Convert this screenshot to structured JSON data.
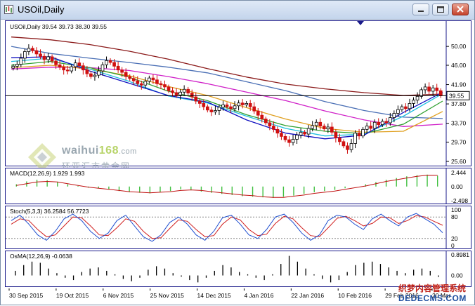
{
  "window": {
    "title": "USOil,Daily"
  },
  "watermark": {
    "site_prefix": "waihui",
    "site_number": "168",
    "site_suffix": ".com",
    "chinese": "环亚汇市黄金网"
  },
  "corner_watermark": {
    "line1": "织梦内容管理系统",
    "line2": "DEDECMS.COM"
  },
  "colors": {
    "pane_border": "#1a1a8a",
    "bull_candle": "#000000",
    "bear_candle": "#d01010",
    "ma_darkred": "#8b1a1a",
    "ma_blue": "#4a6fb5",
    "ma_magenta": "#d020c8",
    "ma_orange": "#e0a020",
    "ma_green": "#30a030",
    "ma_cyan": "#20c0e0",
    "ma_navy": "#1010c0",
    "macd_hist": "#40c040",
    "macd_signal": "#c01010",
    "stoch_main": "#2050d0",
    "stoch_signal": "#d02020",
    "osma_hist": "#000000",
    "price_line": "#000000"
  },
  "chart_data": [
    {
      "id": "price",
      "type": "candlestick",
      "title": "USOil,Daily  39.54 39.73 38.30 39.55",
      "current_price": 39.55,
      "ylim": [
        25.6,
        53.0
      ],
      "yticks": [
        "50.00",
        "46.00",
        "41.90",
        "37.80",
        "33.70",
        "29.70",
        "25.60"
      ],
      "x_labels": [
        "30 Sep 2015",
        "19 Oct 2015",
        "6 Nov 2015",
        "25 Nov 2015",
        "14 Dec 2015",
        "4 Jan 2016",
        "22 Jan 2016",
        "10 Feb 2016",
        "29 Feb 2016",
        "20 Mar"
      ],
      "closes": [
        45.8,
        46.2,
        47.5,
        48.9,
        49.6,
        49.1,
        48.4,
        47.9,
        47.2,
        47.8,
        46.9,
        46.1,
        45.6,
        45.0,
        44.8,
        45.7,
        46.5,
        45.9,
        45.0,
        44.2,
        43.6,
        43.9,
        44.8,
        46.1,
        47.0,
        46.6,
        45.8,
        45.0,
        44.5,
        43.6,
        43.2,
        42.7,
        42.1,
        41.8,
        42.6,
        43.3,
        42.9,
        42.1,
        41.9,
        41.4,
        40.6,
        40.2,
        39.7,
        40.3,
        40.9,
        40.1,
        39.3,
        38.4,
        37.9,
        37.2,
        36.5,
        36.1,
        36.4,
        37.1,
        37.6,
        37.2,
        36.8,
        37.4,
        38.0,
        37.6,
        37.9,
        37.2,
        36.3,
        35.4,
        34.6,
        33.8,
        33.1,
        32.4,
        31.6,
        30.9,
        30.2,
        29.6,
        30.3,
        31.2,
        31.8,
        31.4,
        32.6,
        33.2,
        33.9,
        33.1,
        32.5,
        32.9,
        31.8,
        30.6,
        29.8,
        28.9,
        28.1,
        29.4,
        31.6,
        31.0,
        32.4,
        33.1,
        32.6,
        33.9,
        33.4,
        34.1,
        33.8,
        34.9,
        35.8,
        36.6,
        37.2,
        36.8,
        37.9,
        38.6,
        39.4,
        40.8,
        41.4,
        40.5,
        41.2,
        40.6,
        39.55
      ],
      "moving_averages": [
        {
          "color_key": "ma_darkred",
          "values": [
            52.0,
            51.4,
            50.4,
            49.0,
            47.3,
            45.3,
            43.5,
            42.0,
            41.0,
            40.2,
            39.6,
            39.9
          ]
        },
        {
          "color_key": "ma_blue",
          "values": [
            50.0,
            48.5,
            47.5,
            46.6,
            45.6,
            44.4,
            42.5,
            40.6,
            38.3,
            36.4,
            35.0,
            34.7
          ]
        },
        {
          "color_key": "ma_magenta",
          "values": [
            45.2,
            45.6,
            45.5,
            44.9,
            43.6,
            42.1,
            40.3,
            38.5,
            36.3,
            34.4,
            33.0,
            33.5
          ]
        },
        {
          "color_key": "ma_orange",
          "values": [
            45.5,
            46.0,
            45.2,
            43.8,
            41.5,
            39.6,
            37.0,
            34.6,
            32.6,
            31.8,
            32.0,
            36.2
          ]
        },
        {
          "color_key": "ma_green",
          "values": [
            46.0,
            46.8,
            45.5,
            43.5,
            40.5,
            38.5,
            35.5,
            33.2,
            32.0,
            31.5,
            33.5,
            38.4
          ]
        },
        {
          "color_key": "ma_cyan",
          "values": [
            46.8,
            47.5,
            45.2,
            42.6,
            39.5,
            38.0,
            35.2,
            32.6,
            31.0,
            31.4,
            35.2,
            40.0
          ]
        },
        {
          "color_key": "ma_navy",
          "values": [
            47.6,
            47.8,
            44.8,
            42.2,
            39.6,
            38.2,
            34.4,
            31.6,
            30.4,
            31.2,
            36.0,
            40.3
          ]
        }
      ]
    },
    {
      "id": "macd",
      "type": "histogram",
      "title": "MACD(12,26,9) 1.929 1.993",
      "ylim": [
        -2.498,
        2.444
      ],
      "yticks": [
        "2.444",
        "0.00",
        "-2.498"
      ],
      "hist": [
        0.4,
        0.9,
        1.2,
        1.1,
        0.8,
        0.4,
        0.1,
        -0.2,
        -0.3,
        -0.5,
        -0.8,
        -1.0,
        -1.1,
        -1.2,
        -1.0,
        -0.8,
        -0.5,
        -0.6,
        -0.9,
        -1.1,
        -1.3,
        -1.5,
        -1.7,
        -1.8,
        -1.9,
        -2.0,
        -1.8,
        -1.6,
        -1.3,
        -1.0,
        -0.8,
        -0.6,
        -0.3,
        0.0,
        0.4,
        0.8,
        1.2,
        1.5,
        1.8,
        2.0,
        2.1,
        1.9
      ],
      "signal": [
        0.2,
        0.5,
        0.8,
        0.9,
        0.8,
        0.5,
        0.2,
        -0.1,
        -0.3,
        -0.5,
        -0.7,
        -0.9,
        -1.0,
        -1.1,
        -1.0,
        -0.9,
        -0.7,
        -0.6,
        -0.7,
        -0.9,
        -1.1,
        -1.3,
        -1.5,
        -1.6,
        -1.8,
        -1.9,
        -1.9,
        -1.7,
        -1.5,
        -1.2,
        -1.0,
        -0.8,
        -0.5,
        -0.2,
        0.1,
        0.5,
        0.9,
        1.2,
        1.5,
        1.8,
        2.0,
        1.99
      ]
    },
    {
      "id": "stoch",
      "type": "line",
      "title": "Stoch(5,3,3) 36.2584 56.7723",
      "ylim": [
        0,
        100
      ],
      "yticks": [
        "100",
        "80",
        "20",
        "0"
      ],
      "main": [
        70,
        85,
        60,
        30,
        15,
        40,
        75,
        88,
        70,
        40,
        20,
        35,
        70,
        85,
        55,
        25,
        12,
        30,
        65,
        80,
        60,
        30,
        15,
        40,
        78,
        85,
        60,
        30,
        20,
        45,
        80,
        88,
        65,
        35,
        15,
        30,
        70,
        85,
        80,
        60,
        45,
        75,
        88,
        70,
        55,
        80,
        90,
        75,
        60,
        36
      ],
      "signal": [
        60,
        75,
        70,
        45,
        25,
        30,
        55,
        80,
        78,
        55,
        30,
        28,
        50,
        75,
        68,
        40,
        20,
        22,
        48,
        72,
        68,
        45,
        25,
        28,
        60,
        80,
        72,
        45,
        28,
        32,
        62,
        82,
        75,
        50,
        28,
        25,
        50,
        76,
        82,
        70,
        55,
        62,
        80,
        78,
        62,
        70,
        84,
        80,
        68,
        56.77
      ]
    },
    {
      "id": "osma",
      "type": "histogram",
      "title": "OsMA(12,26,9) -0.0638",
      "ylim": [
        -0.35,
        0.8981
      ],
      "yticks": [
        "0.8981",
        "0.00"
      ],
      "hist": [
        0.2,
        0.45,
        0.6,
        0.55,
        0.3,
        0.1,
        -0.1,
        -0.2,
        0.15,
        0.3,
        0.35,
        0.2,
        0.05,
        -0.15,
        -0.25,
        -0.1,
        0.25,
        0.4,
        0.3,
        0.1,
        -0.05,
        -0.2,
        -0.3,
        -0.1,
        0.2,
        0.45,
        0.35,
        0.15,
        0.05,
        -0.1,
        -0.2,
        0.05,
        0.5,
        0.85,
        0.6,
        0.3,
        0.05,
        -0.15,
        -0.3,
        -0.2,
        0.15,
        0.45,
        0.55,
        0.6,
        0.5,
        0.35,
        0.2,
        0.1,
        0.25,
        0.3,
        0.2,
        -0.06
      ]
    }
  ]
}
